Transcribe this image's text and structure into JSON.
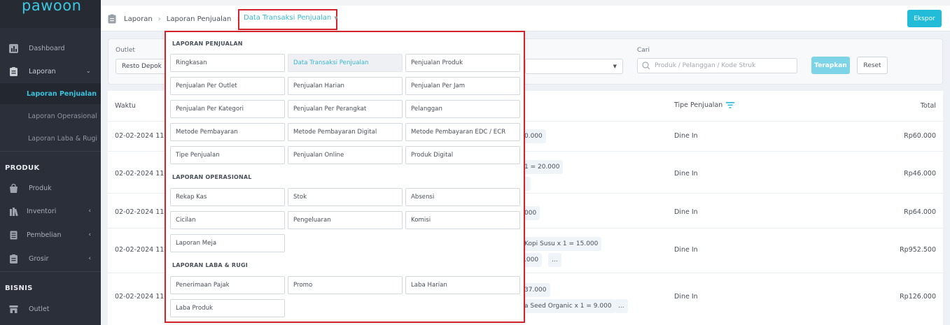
{
  "brand": {
    "logo": "pawoon"
  },
  "sidebar": {
    "dashboard": "Dashboard",
    "laporan": "Laporan",
    "sub": [
      "Laporan Penjualan",
      "Laporan Operasional",
      "Laporan Laba & Rugi"
    ],
    "produk_section": "PRODUK",
    "produk": "Produk",
    "inventori": "Inventori",
    "pembelian": "Pembelian",
    "grosir": "Grosir",
    "bisnis_section": "BISNIS",
    "outlet": "Outlet"
  },
  "breadcrumb": {
    "items": [
      "Laporan",
      "Laporan Penjualan"
    ],
    "active": "Data Transaksi Penjualan"
  },
  "toolbar": {
    "export": "Ekspor"
  },
  "filters": {
    "outlet_label": "Outlet",
    "outlet_value": "Resto Depok",
    "search_label": "Cari",
    "search_placeholder": "Produk / Pelanggan / Kode Struk",
    "apply": "Terapkan",
    "reset": "Reset"
  },
  "table": {
    "headers": {
      "waktu": "Waktu",
      "tipe": "Tipe Penjualan",
      "total": "Total"
    },
    "rows": [
      {
        "time": "02-02-2024 11:",
        "chips": [
          "0.000"
        ],
        "type": "Dine In",
        "total": "Rp60.000"
      },
      {
        "time": "02-02-2024 11:",
        "chips": [
          "1 = 20.000",
          ""
        ],
        "type": "Dine In",
        "total": "Rp46.000"
      },
      {
        "time": "02-02-2024 11:",
        "chips": [
          "000"
        ],
        "type": "Dine In",
        "total": "Rp64.000"
      },
      {
        "time": "02-02-2024 11:",
        "chips": [
          "Kopi Susu x 1 = 15.000",
          ".000",
          "..."
        ],
        "type": "Dine In",
        "total": "Rp952.500"
      },
      {
        "time": "02-02-2024 11:",
        "chips": [
          "37.000",
          "a Seed Organic x 1 = 9.000",
          "..."
        ],
        "type": "Dine In",
        "total": "Rp126.000"
      }
    ]
  },
  "menu": {
    "section1": "LAPORAN PENJUALAN",
    "penjualan": [
      "Ringkasan",
      "Data Transaksi Penjualan",
      "Penjualan Produk",
      "Penjualan Per Outlet",
      "Penjualan Harian",
      "Penjualan Per Jam",
      "Penjualan Per Kategori",
      "Penjualan Per Perangkat",
      "Pelanggan",
      "Metode Pembayaran",
      "Metode Pembayaran Digital",
      "Metode Pembayaran EDC / ECR",
      "Tipe Penjualan",
      "Penjualan Online",
      "Produk Digital"
    ],
    "section2": "LAPORAN OPERASIONAL",
    "operasional": [
      "Rekap Kas",
      "Stok",
      "Absensi",
      "Cicilan",
      "Pengeluaran",
      "Komisi",
      "Laporan Meja"
    ],
    "section3": "LAPORAN LABA & RUGI",
    "laba": [
      "Penerimaan Pajak",
      "Promo",
      "Laba Harian",
      "Laba Produk"
    ]
  }
}
